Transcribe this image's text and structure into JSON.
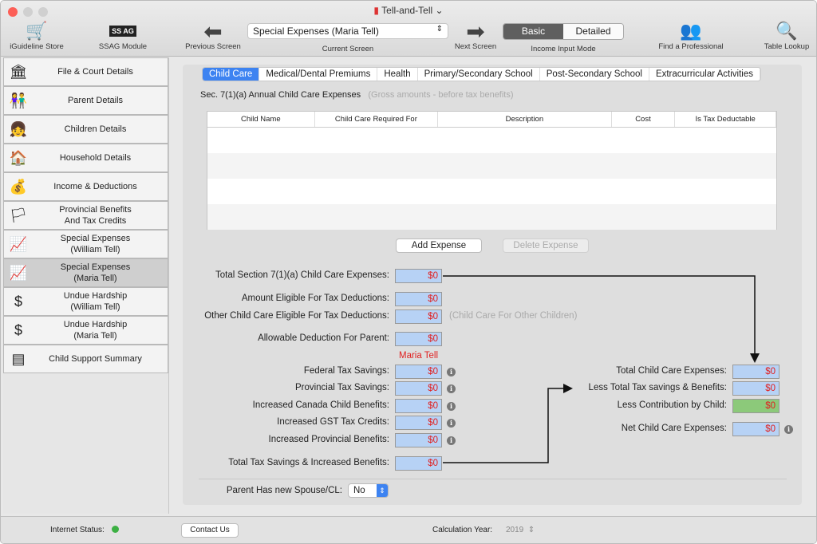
{
  "window": {
    "title": "Tell-and-Tell"
  },
  "toolbar": {
    "store": "iGuideline Store",
    "ssag": "SSAG Module",
    "ssag_icon": "SS AG",
    "prev": "Previous Screen",
    "current_value": "Special Expenses (Maria Tell)",
    "current": "Current Screen",
    "next": "Next Screen",
    "mode_basic": "Basic",
    "mode_detailed": "Detailed",
    "mode_label": "Income Input Mode",
    "find": "Find a Professional",
    "lookup": "Table Lookup"
  },
  "sidebar": {
    "items": [
      {
        "label": "File & Court Details",
        "icon": "🏛"
      },
      {
        "label": "Parent Details",
        "icon": "👫"
      },
      {
        "label": "Children Details",
        "icon": "👧"
      },
      {
        "label": "Household Details",
        "icon": "🏠"
      },
      {
        "label": "Income & Deductions",
        "icon": "💰"
      },
      {
        "label": "Provincial Benefits\nAnd Tax Credits",
        "icon": "🏳"
      },
      {
        "label": "Special Expenses\n(William Tell)",
        "icon": "📈"
      },
      {
        "label": "Special Expenses\n(Maria Tell)",
        "icon": "📈"
      },
      {
        "label": "Undue Hardship\n(William Tell)",
        "icon": "$"
      },
      {
        "label": "Undue Hardship\n(Maria Tell)",
        "icon": "$"
      },
      {
        "label": "Child Support Summary",
        "icon": "▤"
      }
    ]
  },
  "tabs": [
    "Child Care",
    "Medical/Dental Premiums",
    "Health",
    "Primary/Secondary School",
    "Post-Secondary School",
    "Extracurricular Activities"
  ],
  "section": {
    "title": "Sec. 7(1)(a)  Annual Child Care Expenses",
    "note": "(Gross amounts - before tax benefits)"
  },
  "table": {
    "columns": [
      "Child Name",
      "Child Care Required For",
      "Description",
      "Cost",
      "Is Tax Deductable"
    ],
    "rows": []
  },
  "buttons": {
    "add": "Add Expense",
    "delete": "Delete Expense"
  },
  "form": {
    "total_section": {
      "label": "Total Section 7(1)(a) Child Care Expenses:",
      "value": "$0"
    },
    "amount_eligible": {
      "label": "Amount Eligible For Tax Deductions:",
      "value": "$0"
    },
    "other_eligible": {
      "label": "Other Child Care Eligible For Tax Deductions:",
      "value": "$0",
      "note": "(Child Care For Other Children)"
    },
    "allowable": {
      "label": "Allowable Deduction For Parent:",
      "value": "$0"
    },
    "parent_name": "Maria Tell",
    "federal": {
      "label": "Federal Tax Savings:",
      "value": "$0"
    },
    "provincial": {
      "label": "Provincial Tax Savings:",
      "value": "$0"
    },
    "ccb": {
      "label": "Increased Canada Child Benefits:",
      "value": "$0"
    },
    "gst": {
      "label": "Increased GST Tax Credits:",
      "value": "$0"
    },
    "prov_ben": {
      "label": "Increased Provincial Benefits:",
      "value": "$0"
    },
    "total_savings": {
      "label": "Total Tax Savings & Increased Benefits:",
      "value": "$0"
    },
    "total_cc": {
      "label": "Total Child Care Expenses:",
      "value": "$0"
    },
    "less_savings": {
      "label": "Less Total Tax savings & Benefits:",
      "value": "$0"
    },
    "less_child": {
      "label": "Less Contribution by Child:",
      "value": "$0"
    },
    "net": {
      "label": "Net Child Care Expenses:",
      "value": "$0"
    },
    "spouse": {
      "label": "Parent Has new Spouse/CL:",
      "value": "No"
    }
  },
  "status": {
    "internet": "Internet Status:",
    "internet_color": "#3cb043",
    "contact": "Contact Us",
    "calc_year_label": "Calculation Year:",
    "calc_year": "2019"
  }
}
